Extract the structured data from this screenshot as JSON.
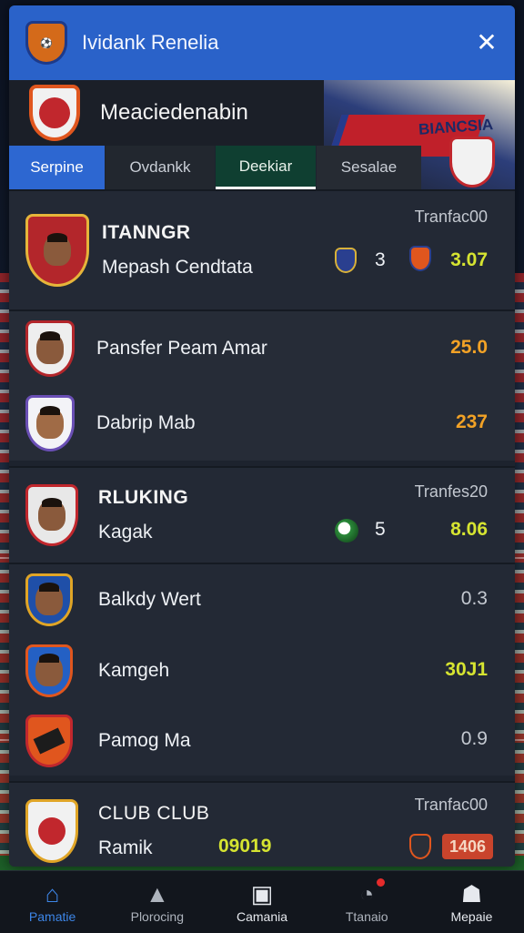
{
  "window": {
    "title": "Ividank Renelia",
    "close_icon": "close-icon"
  },
  "club": {
    "name": "Meaciedenabin",
    "banner_text": "BIANCSIA"
  },
  "tabs": [
    {
      "label": "Serpine",
      "active": true
    },
    {
      "label": "Ovdankk",
      "active": false
    },
    {
      "label": "Deekiar",
      "active": false
    },
    {
      "label": "Sesalae",
      "active": false
    }
  ],
  "groups": [
    {
      "title": "ITANNGR",
      "label": "Tranfac00",
      "rows": [
        {
          "name": "Mepash Cendtata",
          "badge_count": "3",
          "value": "3.07",
          "value_color": "#d6e431"
        },
        {
          "name": "Pansfer Peam Amar",
          "value": "25.0",
          "value_color": "#f2a226"
        },
        {
          "name": "Dabrip Mab",
          "value": "237",
          "value_color": "#f2a226"
        }
      ]
    },
    {
      "title": "RLUKING",
      "label": "Tranfes20",
      "rows": [
        {
          "name": "Kagak",
          "badge_count": "5",
          "value": "8.06",
          "value_color": "#d6e431"
        },
        {
          "name": "Balkdy Wert",
          "value": "0.3",
          "value_color": "#c4c9d1"
        },
        {
          "name": "Kamgeh",
          "value": "30J1",
          "value_color": "#d6e431"
        },
        {
          "name": "Pamog Ma",
          "value": "0.9",
          "value_color": "#c4c9d1"
        }
      ]
    },
    {
      "title": "CLUB CLUB",
      "label": "Tranfac00",
      "rows": [
        {
          "name": "Ramik",
          "mid_value": "09019",
          "value": "1406",
          "value_color": "#f5d7c3"
        }
      ]
    }
  ],
  "nav": [
    {
      "label": "Pamatie",
      "icon": "home-icon",
      "active": true
    },
    {
      "label": "Plorocing",
      "icon": "stadium-icon",
      "active": false
    },
    {
      "label": "Camania",
      "icon": "tactics-board-icon",
      "active": false
    },
    {
      "label": "Ttanaio",
      "icon": "timer-icon",
      "active": false,
      "notification": true
    },
    {
      "label": "Mepaie",
      "icon": "profile-icon",
      "active": false
    }
  ]
}
